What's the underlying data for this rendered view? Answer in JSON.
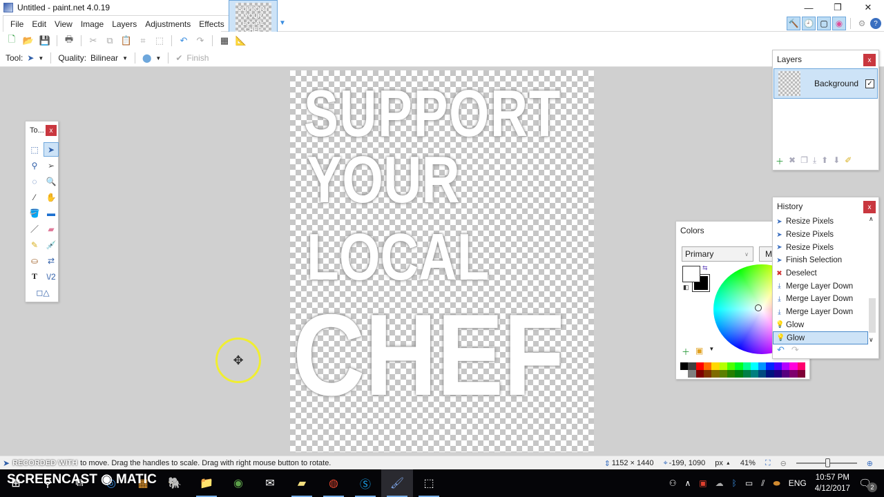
{
  "window": {
    "title": "Untitled - paint.net 4.0.19",
    "minimize": "—",
    "maximize": "❐",
    "close": "✕"
  },
  "menu": [
    "File",
    "Edit",
    "View",
    "Image",
    "Layers",
    "Adjustments",
    "Effects"
  ],
  "thumbnail": {
    "text": "SUPPORT YOUR LOCAL CHEF"
  },
  "toolbar": {
    "icons": [
      "new-icon",
      "open-icon",
      "save-icon",
      "print-icon",
      "cut-icon",
      "copy-icon",
      "paste-icon",
      "crop-icon",
      "deselect-icon",
      "undo-icon",
      "redo-icon",
      "grid-icon",
      "ruler-icon"
    ]
  },
  "tool_options": {
    "tool_label": "Tool:",
    "quality_label": "Quality:",
    "quality_value": "Bilinear",
    "finish_label": "Finish"
  },
  "window_toggles": [
    "tools",
    "history",
    "layers",
    "colors",
    "settings",
    "help"
  ],
  "canvas": {
    "lines": [
      "SUPPORT",
      "YOUR",
      "LOCAL",
      "CHEF"
    ]
  },
  "tools_panel": {
    "title": "To...",
    "tools": [
      "rectangle-select",
      "move-selected",
      "lasso-select",
      "move-selection",
      "ellipse-select",
      "zoom",
      "magic-wand",
      "pan",
      "paint-bucket",
      "gradient",
      "paintbrush",
      "eraser",
      "pencil",
      "color-picker",
      "clone-stamp",
      "recolor",
      "text",
      "line-curve",
      "shapes"
    ]
  },
  "layers_panel": {
    "title": "Layers",
    "layers": [
      {
        "name": "Background",
        "visible": true
      }
    ]
  },
  "history_panel": {
    "title": "History",
    "items": [
      {
        "label": "Resize Pixels",
        "icon": "move-icon"
      },
      {
        "label": "Resize Pixels",
        "icon": "move-icon"
      },
      {
        "label": "Resize Pixels",
        "icon": "move-icon"
      },
      {
        "label": "Finish Selection",
        "icon": "move-icon"
      },
      {
        "label": "Deselect",
        "icon": "deselect-icon"
      },
      {
        "label": "Merge Layer Down",
        "icon": "merge-icon"
      },
      {
        "label": "Merge Layer Down",
        "icon": "merge-icon"
      },
      {
        "label": "Merge Layer Down",
        "icon": "merge-icon"
      },
      {
        "label": "Glow",
        "icon": "bulb-icon"
      },
      {
        "label": "Glow",
        "icon": "bulb-icon",
        "selected": true
      }
    ]
  },
  "colors_panel": {
    "title": "Colors",
    "mode": "Primary",
    "more_label": "M",
    "primary": "#ffffff",
    "secondary": "#000000",
    "palette_top": [
      "#000000",
      "#404040",
      "#ff0000",
      "#ff6a00",
      "#ffd800",
      "#b6ff00",
      "#4cff00",
      "#00ff21",
      "#00ff90",
      "#00ffff",
      "#0094ff",
      "#0026ff",
      "#4800ff",
      "#b200ff",
      "#ff00dc",
      "#ff006e"
    ],
    "palette_bottom": [
      "#ffffff",
      "#808080",
      "#7f0000",
      "#7f3300",
      "#7f6a00",
      "#5b7f00",
      "#267f00",
      "#007f0e",
      "#007f46",
      "#007f7f",
      "#004a7f",
      "#00137f",
      "#21007f",
      "#57007f",
      "#7f006e",
      "#7f0037"
    ]
  },
  "status": {
    "hint": "to move. Drag the handles to scale. Drag with right mouse button to rotate.",
    "image_size": "1152 × 1440",
    "cursor_pos": "-199, 1090",
    "units": "px",
    "zoom": "41%"
  },
  "watermark": "SCREENCAST ◉ MATIC",
  "watermark_small": "RECORDED WITH",
  "taskbar": {
    "apps": [
      "start",
      "search",
      "task-view",
      "store",
      "evernote",
      "file-explorer",
      "tripadvisor",
      "mail",
      "sticky-notes",
      "chrome",
      "skype",
      "paint.net",
      "snipping"
    ],
    "tray": {
      "language": "ENG",
      "time": "10:57 PM",
      "date": "4/12/2017",
      "notifications": "2"
    }
  }
}
